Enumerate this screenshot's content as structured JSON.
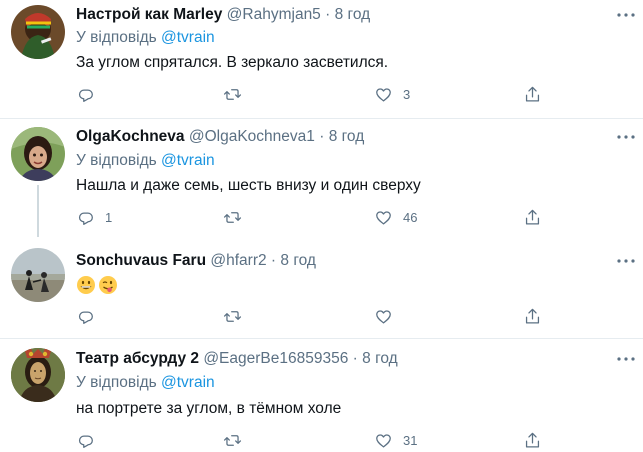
{
  "tweets": [
    {
      "name": "Настрой как Marley",
      "handle": "@Rahymjan5",
      "dot": "·",
      "time": "8 год",
      "reply_prefix": "У відповідь",
      "reply_mention": "@tvrain",
      "text": "За углом спрятался. В зеркало засветился.",
      "replies": "",
      "retweets": "",
      "likes": "3"
    },
    {
      "name": "OlgaKochneva",
      "handle": "@OlgaKochneva1",
      "dot": "·",
      "time": "8 год",
      "reply_prefix": "У відповідь",
      "reply_mention": "@tvrain",
      "text": "Нашла и даже семь, шесть  внизу и один сверху",
      "replies": "1",
      "retweets": "",
      "likes": "46"
    },
    {
      "name": "Sonchuvaus Faru",
      "handle": "@hfarr2",
      "dot": "·",
      "time": "8 год",
      "text": "",
      "emoji": [
        "grinning-face",
        "winking-face-with-tongue"
      ],
      "replies": "",
      "retweets": "",
      "likes": ""
    },
    {
      "name": "Театр абсурду 2",
      "handle": "@EagerBe16859356",
      "dot": "·",
      "time": "8 год",
      "reply_prefix": "У відповідь",
      "reply_mention": "@tvrain",
      "text": "на портрете за углом, в тёмном холе",
      "replies": "",
      "retweets": "",
      "likes": "31"
    }
  ],
  "icons": {
    "reply": "reply-icon",
    "retweet": "retweet-icon",
    "like": "heart-icon",
    "share": "share-icon",
    "more": "more-icon"
  },
  "colors": {
    "text": "#0f1419",
    "secondary": "#5b7083",
    "link": "#1b95e0",
    "divider": "#e6ecf0"
  }
}
